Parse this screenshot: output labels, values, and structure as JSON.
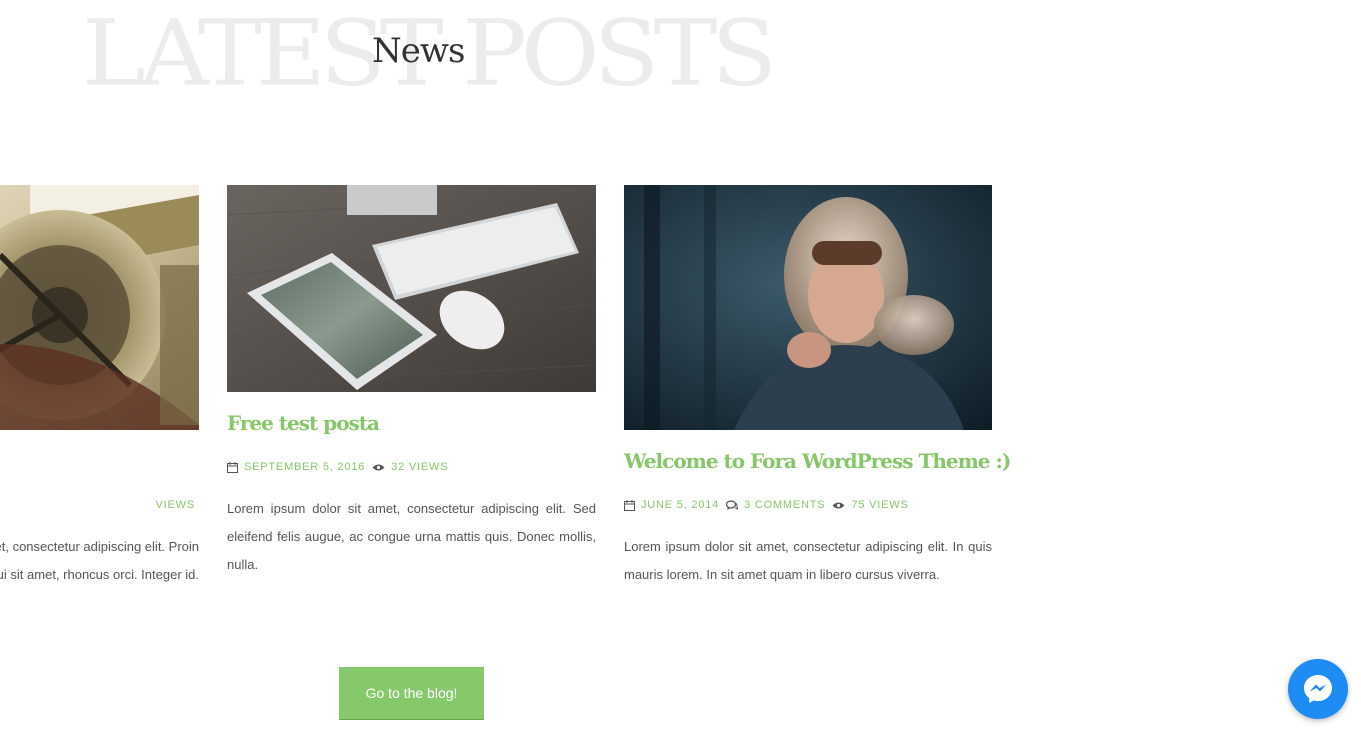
{
  "section": {
    "background_title": "LATEST POSTS",
    "title": "News"
  },
  "posts": [
    {
      "title": "",
      "meta": {
        "views": "VIEWS"
      },
      "excerpt": "Lorem ipsum dolor sit amet, consectetur adipiscing elit. Proin dui sit amet, rhoncus orci. Integer id."
    },
    {
      "title": "Free test posta",
      "meta": {
        "date": "SEPTEMBER 5, 2016",
        "views": "32 VIEWS"
      },
      "excerpt": "Lorem ipsum dolor sit amet, consectetur adipiscing elit. Sed eleifend felis augue, ac congue urna mattis quis. Donec mollis, nulla."
    },
    {
      "title": "Welcome to Fora WordPress Theme :)",
      "meta": {
        "date": "JUNE 5, 2014",
        "comments": "3 COMMENTS",
        "views": "75 VIEWS"
      },
      "excerpt": "Lorem ipsum dolor sit amet, consectetur adipiscing elit. In quis mauris lorem. In sit amet quam in libero cursus viverra."
    }
  ],
  "actions": {
    "blog_button": "Go to the blog!"
  },
  "colors": {
    "accent": "#86c96b",
    "messenger": "#1f8bf5"
  },
  "icons": [
    "calendar-icon",
    "eye-icon",
    "comments-icon",
    "messenger-icon"
  ]
}
